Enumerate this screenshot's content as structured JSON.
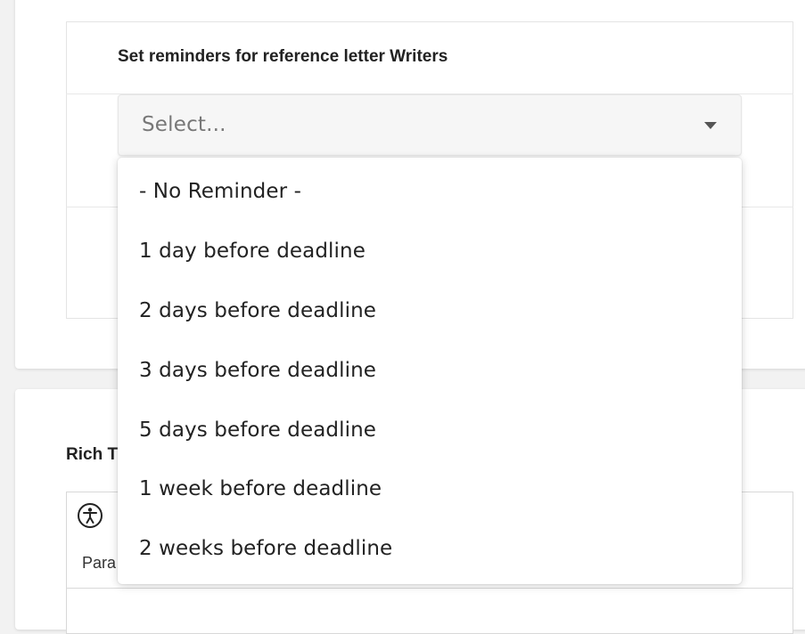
{
  "reminders": {
    "label": "Set reminders for reference letter Writers",
    "select": {
      "placeholder": "Select..."
    },
    "options": [
      "- No Reminder -",
      "1 day before deadline",
      "2 days before deadline",
      "3 days before deadline",
      "5 days before deadline",
      "1 week before deadline",
      "2 weeks before deadline"
    ]
  },
  "rich_text": {
    "label": "Rich T",
    "accessibility_icon": "accessibility-icon",
    "paragraph_label": "Para"
  },
  "colors": {
    "background": "#f2f2f2",
    "card": "#ffffff",
    "select_bg": "#f6f6f6",
    "placeholder": "#777777",
    "text": "#222222"
  }
}
